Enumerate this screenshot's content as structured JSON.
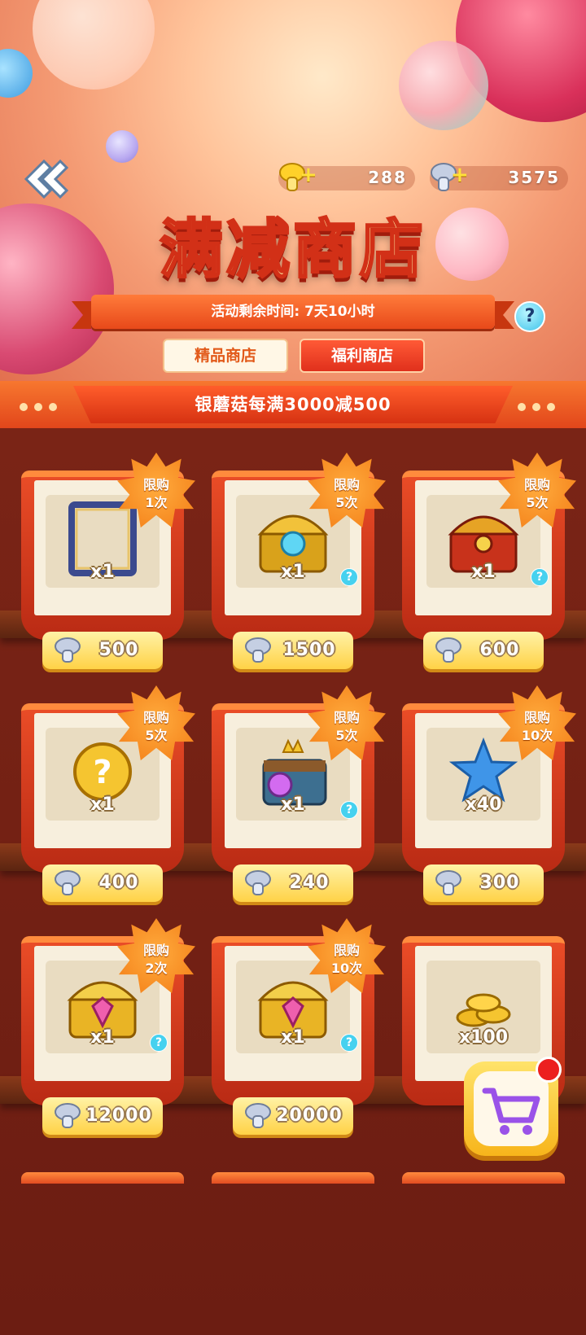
{
  "header": {
    "currencies": [
      {
        "name": "gold-mushroom",
        "amount": "288",
        "color": "#ffd12a"
      },
      {
        "name": "silver-mushroom",
        "amount": "3575",
        "color": "#c5cfe3"
      }
    ],
    "title": "满减商店",
    "countdown": "活动剩余时间: 7天10小时",
    "help": "?"
  },
  "tabs": [
    {
      "label": "精品商店",
      "active": false
    },
    {
      "label": "福利商店",
      "active": true
    }
  ],
  "promo": "银蘑菇每满3000减500",
  "items": [
    {
      "limit_top": "限购",
      "limit_bottom": "1次",
      "qty": "x1",
      "price": "500",
      "icon": "avatar-frame-icon",
      "has_help": false
    },
    {
      "limit_top": "限购",
      "limit_bottom": "5次",
      "qty": "x1",
      "price": "1500",
      "icon": "blue-treasure-chest-icon",
      "has_help": true
    },
    {
      "limit_top": "限购",
      "limit_bottom": "5次",
      "qty": "x1",
      "price": "600",
      "icon": "red-treasure-chest-icon",
      "has_help": true
    },
    {
      "limit_top": "限购",
      "limit_bottom": "5次",
      "qty": "x1",
      "price": "400",
      "icon": "mystery-coin-icon",
      "has_help": false
    },
    {
      "limit_top": "限购",
      "limit_bottom": "5次",
      "qty": "x1",
      "price": "240",
      "icon": "crown-chest-icon",
      "has_help": true
    },
    {
      "limit_top": "限购",
      "limit_bottom": "10次",
      "qty": "x40",
      "price": "300",
      "icon": "blue-star-icon",
      "has_help": false
    },
    {
      "limit_top": "限购",
      "limit_bottom": "2次",
      "qty": "x1",
      "price": "12000",
      "icon": "pink-gem-chest-icon",
      "has_help": true
    },
    {
      "limit_top": "限购",
      "limit_bottom": "10次",
      "qty": "x1",
      "price": "20000",
      "icon": "pink-gem-chest-icon",
      "has_help": true
    },
    {
      "limit_top": "",
      "limit_bottom": "",
      "qty": "x100",
      "price": "",
      "icon": "gold-coins-icon",
      "has_help": false
    }
  ]
}
